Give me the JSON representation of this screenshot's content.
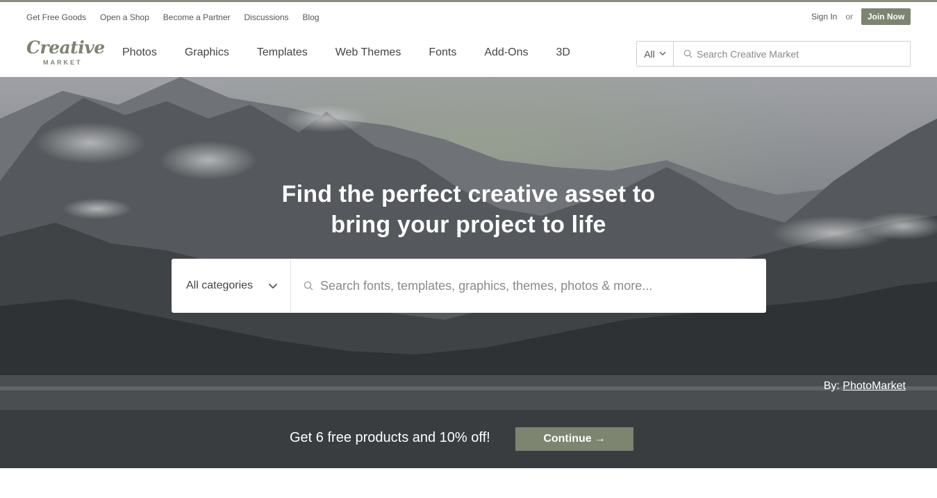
{
  "utility_bar": {
    "links": [
      "Get Free Goods",
      "Open a Shop",
      "Become a Partner",
      "Discussions",
      "Blog"
    ],
    "sign_in": "Sign In",
    "or": "or",
    "join_now": "Join Now"
  },
  "logo": {
    "word": "Creative",
    "sub": "MARKET"
  },
  "nav": {
    "items": [
      "Photos",
      "Graphics",
      "Templates",
      "Web Themes",
      "Fonts",
      "Add-Ons",
      "3D"
    ]
  },
  "top_search": {
    "category": "All",
    "placeholder": "Search Creative Market",
    "icons": {
      "dropdown": "chevron-down-icon",
      "search": "search-icon"
    }
  },
  "hero": {
    "headline_line1": "Find the perfect creative asset to",
    "headline_line2": "bring your project to life",
    "search": {
      "category": "All categories",
      "placeholder": "Search fonts, templates, graphics, themes, photos & more..."
    },
    "credit_prefix": "By:",
    "credit_link": "PhotoMarket"
  },
  "promo": {
    "text": "Get 6 free products and 10% off!",
    "button_label": "Continue",
    "button_arrow": "→"
  },
  "colors": {
    "accent": "#7d8470",
    "promo_bg": "#3a3d40",
    "top_border": "#8a8d7e"
  }
}
